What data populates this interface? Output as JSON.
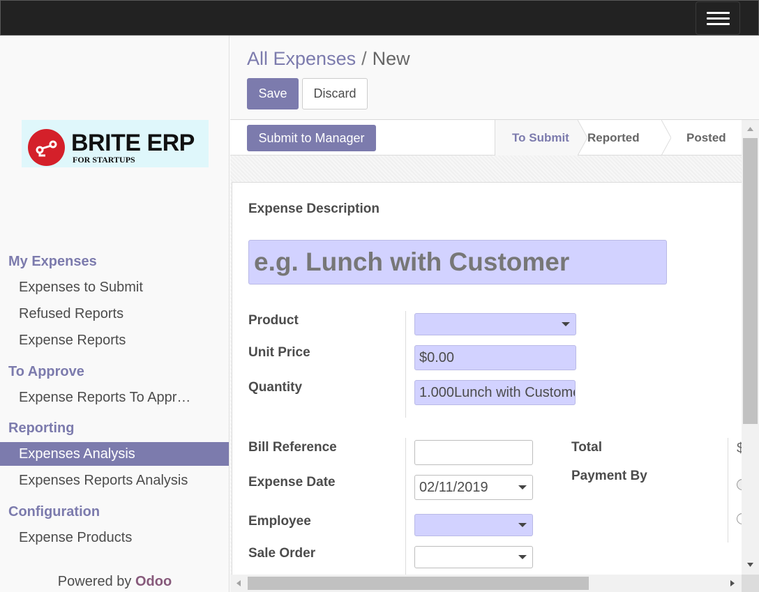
{
  "sidebar": {
    "logo": {
      "title": "BRITE ERP",
      "subtitle": "FOR STARTUPS"
    },
    "sections": [
      {
        "title": "My Expenses",
        "items": [
          "Expenses to Submit",
          "Refused Reports",
          "Expense Reports"
        ]
      },
      {
        "title": "To Approve",
        "items": [
          "Expense Reports To Appr…"
        ]
      },
      {
        "title": "Reporting",
        "items": [
          "Expenses Analysis",
          "Expenses Reports Analysis"
        ]
      },
      {
        "title": "Configuration",
        "items": [
          "Expense Products"
        ]
      }
    ],
    "active_item": "Expenses Analysis",
    "powered_prefix": "Powered by",
    "powered_brand": "Odoo"
  },
  "header": {
    "breadcrumb_parent": "All Expenses",
    "breadcrumb_sep": "/",
    "breadcrumb_current": "New",
    "save_label": "Save",
    "discard_label": "Discard"
  },
  "statusbar": {
    "action_label": "Submit to Manager",
    "stages": [
      "To Submit",
      "Reported",
      "Posted"
    ],
    "current_stage": "To Submit"
  },
  "form": {
    "description_label": "Expense Description",
    "description_placeholder": "e.g. Lunch with Customer",
    "product_label": "Product",
    "product_value": "",
    "unit_price_label": "Unit Price",
    "unit_price_value": "$0.00",
    "quantity_label": "Quantity",
    "quantity_value": "1.000Lunch with Custome",
    "bill_reference_label": "Bill Reference",
    "bill_reference_value": "",
    "expense_date_label": "Expense Date",
    "expense_date_value": "02/11/2019",
    "employee_label": "Employee",
    "employee_value": "",
    "sale_order_label": "Sale Order",
    "sale_order_value": "",
    "total_label": "Total",
    "total_value_partial": "$",
    "payment_by_label": "Payment By"
  },
  "colors": {
    "accent": "#7c7bad",
    "required_field": "#d2d2ff",
    "topbar": "#222222",
    "brand_odoo": "#875a7b",
    "logo_red": "#d4202a"
  }
}
